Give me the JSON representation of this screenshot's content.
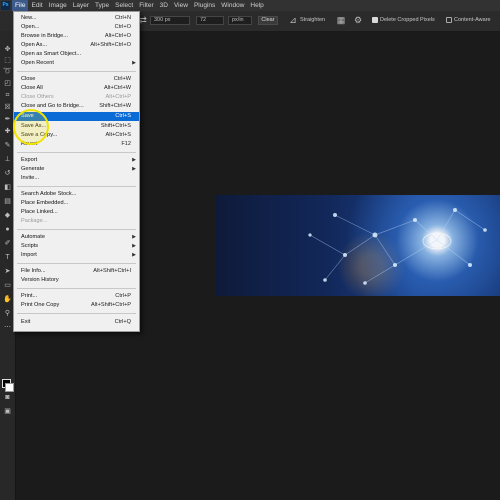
{
  "app": {
    "logo_text": "Ps"
  },
  "menubar": {
    "items": [
      "File",
      "Edit",
      "Image",
      "Layer",
      "Type",
      "Select",
      "Filter",
      "3D",
      "View",
      "Plugins",
      "Window",
      "Help"
    ]
  },
  "options": {
    "width_value": "300 px",
    "resolution_value": "72",
    "resolution_unit": "px/in",
    "clear_label": "Clear",
    "straighten_label": "Straighten",
    "delete_cropped_label": "Delete Cropped Pixels",
    "content_aware_label": "Content-Aware"
  },
  "file_menu": {
    "items": [
      {
        "label": "New...",
        "shortcut": "Ctrl+N"
      },
      {
        "label": "Open...",
        "shortcut": "Ctrl+O"
      },
      {
        "label": "Browse in Bridge...",
        "shortcut": "Alt+Ctrl+O"
      },
      {
        "label": "Open As...",
        "shortcut": "Alt+Shift+Ctrl+O"
      },
      {
        "label": "Open as Smart Object...",
        "shortcut": ""
      },
      {
        "label": "Open Recent",
        "shortcut": ""
      },
      {
        "label": "Close",
        "shortcut": "Ctrl+W"
      },
      {
        "label": "Close All",
        "shortcut": "Alt+Ctrl+W"
      },
      {
        "label": "Close Others",
        "shortcut": "Alt+Ctrl+P"
      },
      {
        "label": "Close and Go to Bridge...",
        "shortcut": "Shift+Ctrl+W"
      },
      {
        "label": "Save",
        "shortcut": "Ctrl+S"
      },
      {
        "label": "Save As...",
        "shortcut": "Shift+Ctrl+S"
      },
      {
        "label": "Save a Copy...",
        "shortcut": "Alt+Ctrl+S"
      },
      {
        "label": "Revert",
        "shortcut": "F12"
      },
      {
        "label": "Export",
        "shortcut": ""
      },
      {
        "label": "Generate",
        "shortcut": ""
      },
      {
        "label": "Invite...",
        "shortcut": ""
      },
      {
        "label": "Search Adobe Stock...",
        "shortcut": ""
      },
      {
        "label": "Place Embedded...",
        "shortcut": ""
      },
      {
        "label": "Place Linked...",
        "shortcut": ""
      },
      {
        "label": "Package...",
        "shortcut": ""
      },
      {
        "label": "Automate",
        "shortcut": ""
      },
      {
        "label": "Scripts",
        "shortcut": ""
      },
      {
        "label": "Import",
        "shortcut": ""
      },
      {
        "label": "File Info...",
        "shortcut": "Alt+Shift+Ctrl+I"
      },
      {
        "label": "Version History",
        "shortcut": ""
      },
      {
        "label": "Print...",
        "shortcut": "Ctrl+P"
      },
      {
        "label": "Print One Copy",
        "shortcut": "Alt+Shift+Ctrl+P"
      },
      {
        "label": "Exit",
        "shortcut": "Ctrl+Q"
      }
    ]
  },
  "tools": [
    "move-icon",
    "marquee-icon",
    "lasso-icon",
    "object-select-icon",
    "crop-icon",
    "frame-icon",
    "eyedropper-icon",
    "healing-icon",
    "brush-icon",
    "stamp-icon",
    "history-brush-icon",
    "eraser-icon",
    "gradient-icon",
    "blur-icon",
    "dodge-icon",
    "pen-icon",
    "type-icon",
    "path-select-icon",
    "shape-icon",
    "hand-icon",
    "zoom-icon",
    "more-tools-icon"
  ],
  "colors": {
    "menu_highlight": "#0a6ad6",
    "menubar_active": "#3c5a8a",
    "cursor_ring": "#f2e400"
  }
}
